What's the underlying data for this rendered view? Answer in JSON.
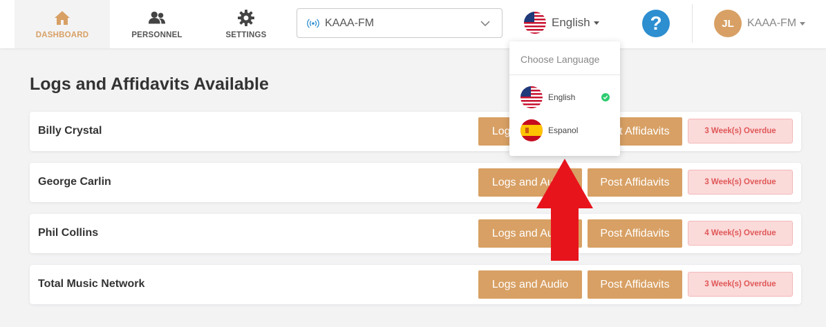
{
  "nav": {
    "items": [
      {
        "label": "DASHBOARD",
        "icon": "home-icon",
        "active": true
      },
      {
        "label": "PERSONNEL",
        "icon": "users-icon",
        "active": false
      },
      {
        "label": "SETTINGS",
        "icon": "gear-icon",
        "active": false
      }
    ]
  },
  "station": {
    "selected": "KAAA-FM",
    "icon": "broadcast-icon"
  },
  "language": {
    "current": "English",
    "icon": "us-flag-icon"
  },
  "help": {
    "label": "?"
  },
  "user": {
    "initials": "JL",
    "station": "KAAA-FM"
  },
  "main": {
    "title": "Logs and Affidavits Available",
    "rows": [
      {
        "name": "Billy Crystal",
        "logs_label": "Logs and Audio",
        "post_label": "Post Affidavits",
        "status": "3 Week(s) Overdue"
      },
      {
        "name": "George Carlin",
        "logs_label": "Logs and Audio",
        "post_label": "Post Affidavits",
        "status": "3 Week(s) Overdue"
      },
      {
        "name": "Phil Collins",
        "logs_label": "Logs and Audio",
        "post_label": "Post Affidavits",
        "status": "4 Week(s) Overdue"
      },
      {
        "name": "Total Music Network",
        "logs_label": "Logs and Audio",
        "post_label": "Post Affidavits",
        "status": "3 Week(s) Overdue"
      }
    ]
  },
  "language_dropdown": {
    "header": "Choose Language",
    "options": [
      {
        "label": "English",
        "icon": "us-flag-icon",
        "selected": true
      },
      {
        "label": "Espanol",
        "icon": "spain-flag-icon",
        "selected": false
      }
    ]
  },
  "colors": {
    "accent": "#d8a064",
    "help": "#2d8ed0",
    "overdue_bg": "#fbdada",
    "overdue_text": "#e05858",
    "annotation_arrow": "#e8141c"
  }
}
